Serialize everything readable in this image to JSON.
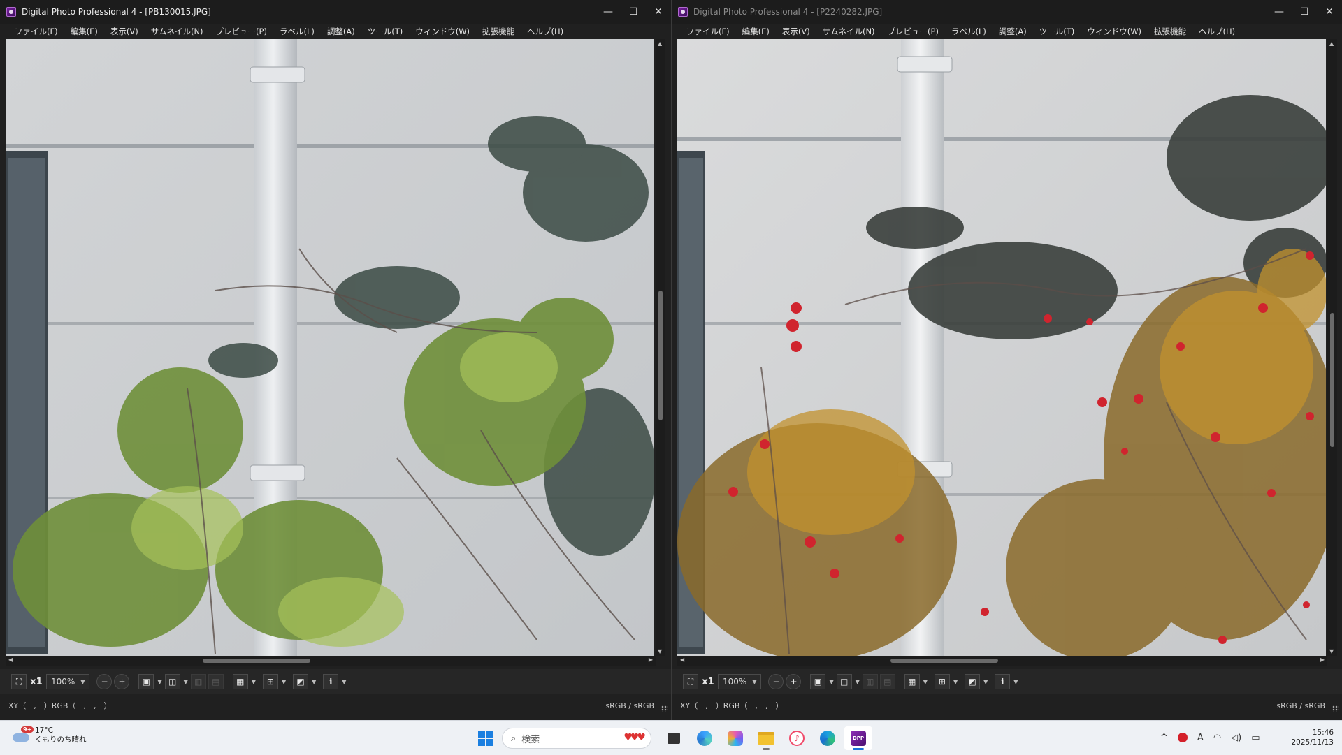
{
  "windows": {
    "left": {
      "title": "Digital Photo Professional 4 - [PB130015.JPG]",
      "menu": [
        "ファイル(F)",
        "編集(E)",
        "表示(V)",
        "サムネイル(N)",
        "プレビュー(P)",
        "ラベル(L)",
        "調整(A)",
        "ツール(T)",
        "ウィンドウ(W)",
        "拡張機能",
        "ヘルプ(H)"
      ],
      "zoom_label": "x1",
      "zoom_value": "100%",
      "status_xy": "XY（　,　）RGB（　,　,　）",
      "status_colorspace": "sRGB / sRGB"
    },
    "right": {
      "title": "Digital Photo Professional 4 - [P2240282.JPG]",
      "menu": [
        "ファイル(F)",
        "編集(E)",
        "表示(V)",
        "サムネイル(N)",
        "プレビュー(P)",
        "ラベル(L)",
        "調整(A)",
        "ツール(T)",
        "ウィンドウ(W)",
        "拡張機能",
        "ヘルプ(H)"
      ],
      "zoom_label": "x1",
      "zoom_value": "100%",
      "status_xy": "XY（　,　）RGB（　,　,　）",
      "status_colorspace": "sRGB / sRGB"
    }
  },
  "window_controls": {
    "minimize": "—",
    "maximize": "☐",
    "close": "✕"
  },
  "taskbar": {
    "weather_badge": "9+",
    "weather_temp": "17°C",
    "weather_desc": "くもりのち晴れ",
    "search_placeholder": "検索",
    "clock_time": "15:46",
    "clock_date": "2025/11/13",
    "ime": "A"
  },
  "icons": {
    "fit": "fit-window-icon",
    "zoom_out": "zoom-out-icon",
    "zoom_in": "zoom-in-icon",
    "single": "single-view-icon",
    "compare": "compare-view-icon",
    "grid": "grid-icon",
    "af": "af-points-icon",
    "highlight": "highlight-warning-icon",
    "info": "info-icon"
  }
}
